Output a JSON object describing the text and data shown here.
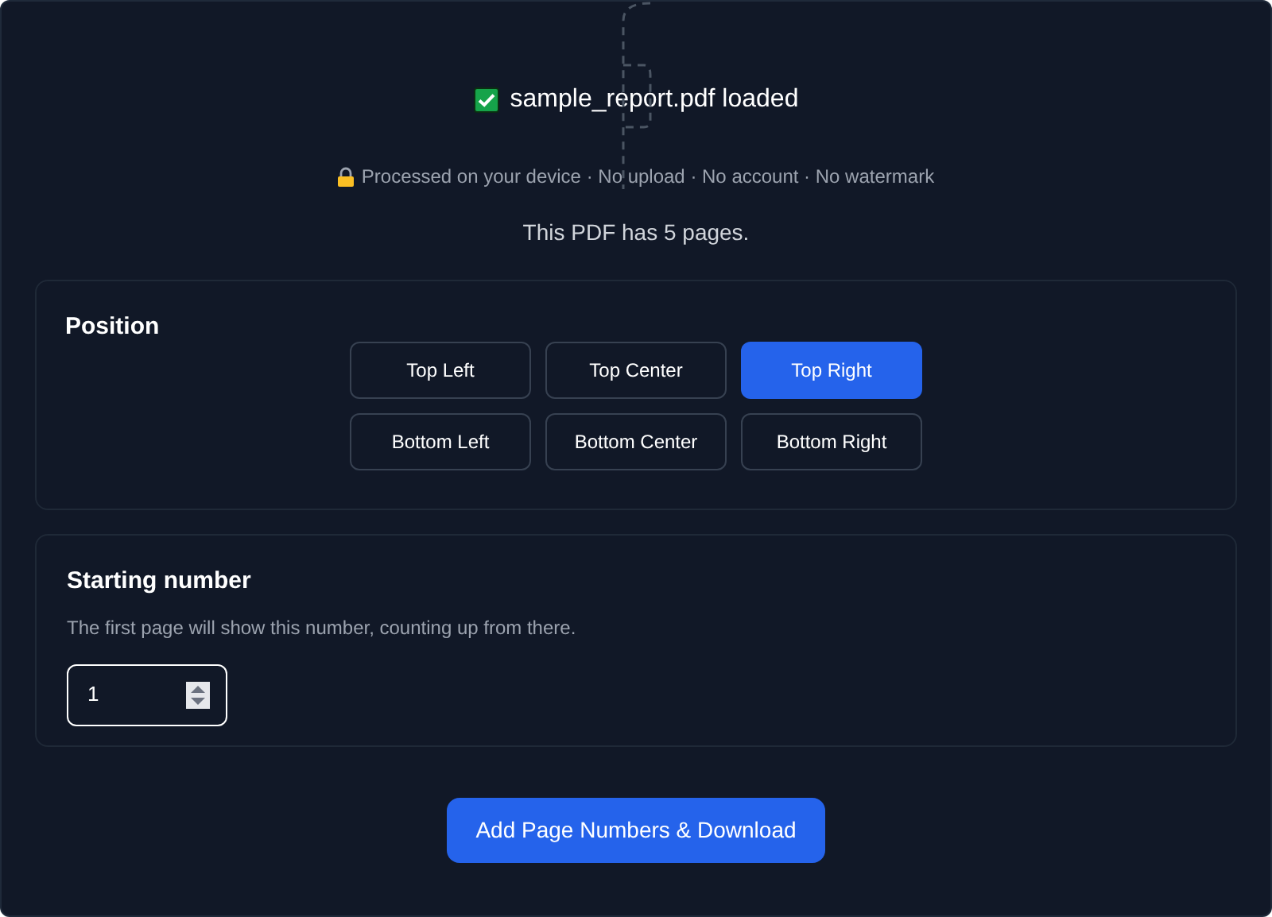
{
  "file_status": {
    "text": "sample_report.pdf loaded"
  },
  "privacy_note": "Processed on your device · No upload · No account · No watermark",
  "page_count": "This PDF has 5 pages.",
  "position": {
    "title": "Position",
    "options": [
      {
        "label": "Top Left",
        "selected": false
      },
      {
        "label": "Top Center",
        "selected": false
      },
      {
        "label": "Top Right",
        "selected": true
      },
      {
        "label": "Bottom Left",
        "selected": false
      },
      {
        "label": "Bottom Center",
        "selected": false
      },
      {
        "label": "Bottom Right",
        "selected": false
      }
    ]
  },
  "starting_number": {
    "title": "Starting number",
    "description": "The first page will show this number, counting up from there.",
    "value": "1"
  },
  "action_button": "Add Page Numbers & Download"
}
